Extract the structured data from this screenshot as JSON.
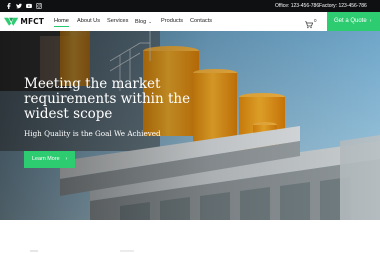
{
  "topbar": {
    "social": [
      "facebook-icon",
      "twitter-icon",
      "youtube-icon",
      "instagram-icon"
    ],
    "office": "Office: 123-456-786",
    "factory": "Factory: 123-456-786"
  },
  "brand": {
    "name": "MFCT"
  },
  "nav": {
    "items": [
      {
        "label": "Home",
        "active": true
      },
      {
        "label": "About Us"
      },
      {
        "label": "Services"
      },
      {
        "label": "Blog",
        "dropdown": true
      },
      {
        "label": "Products"
      },
      {
        "label": "Contacts"
      }
    ],
    "cart_count": "0",
    "quote_label": "Get a Quote"
  },
  "hero": {
    "headline": "Meeting the market requirements within the widest scope",
    "subhead": "High Quality is the Goal We Achieved",
    "cta_label": "Learn More"
  },
  "colors": {
    "accent": "#2ecc71",
    "topbar": "#0f1012",
    "tank": "#f4a21a"
  }
}
